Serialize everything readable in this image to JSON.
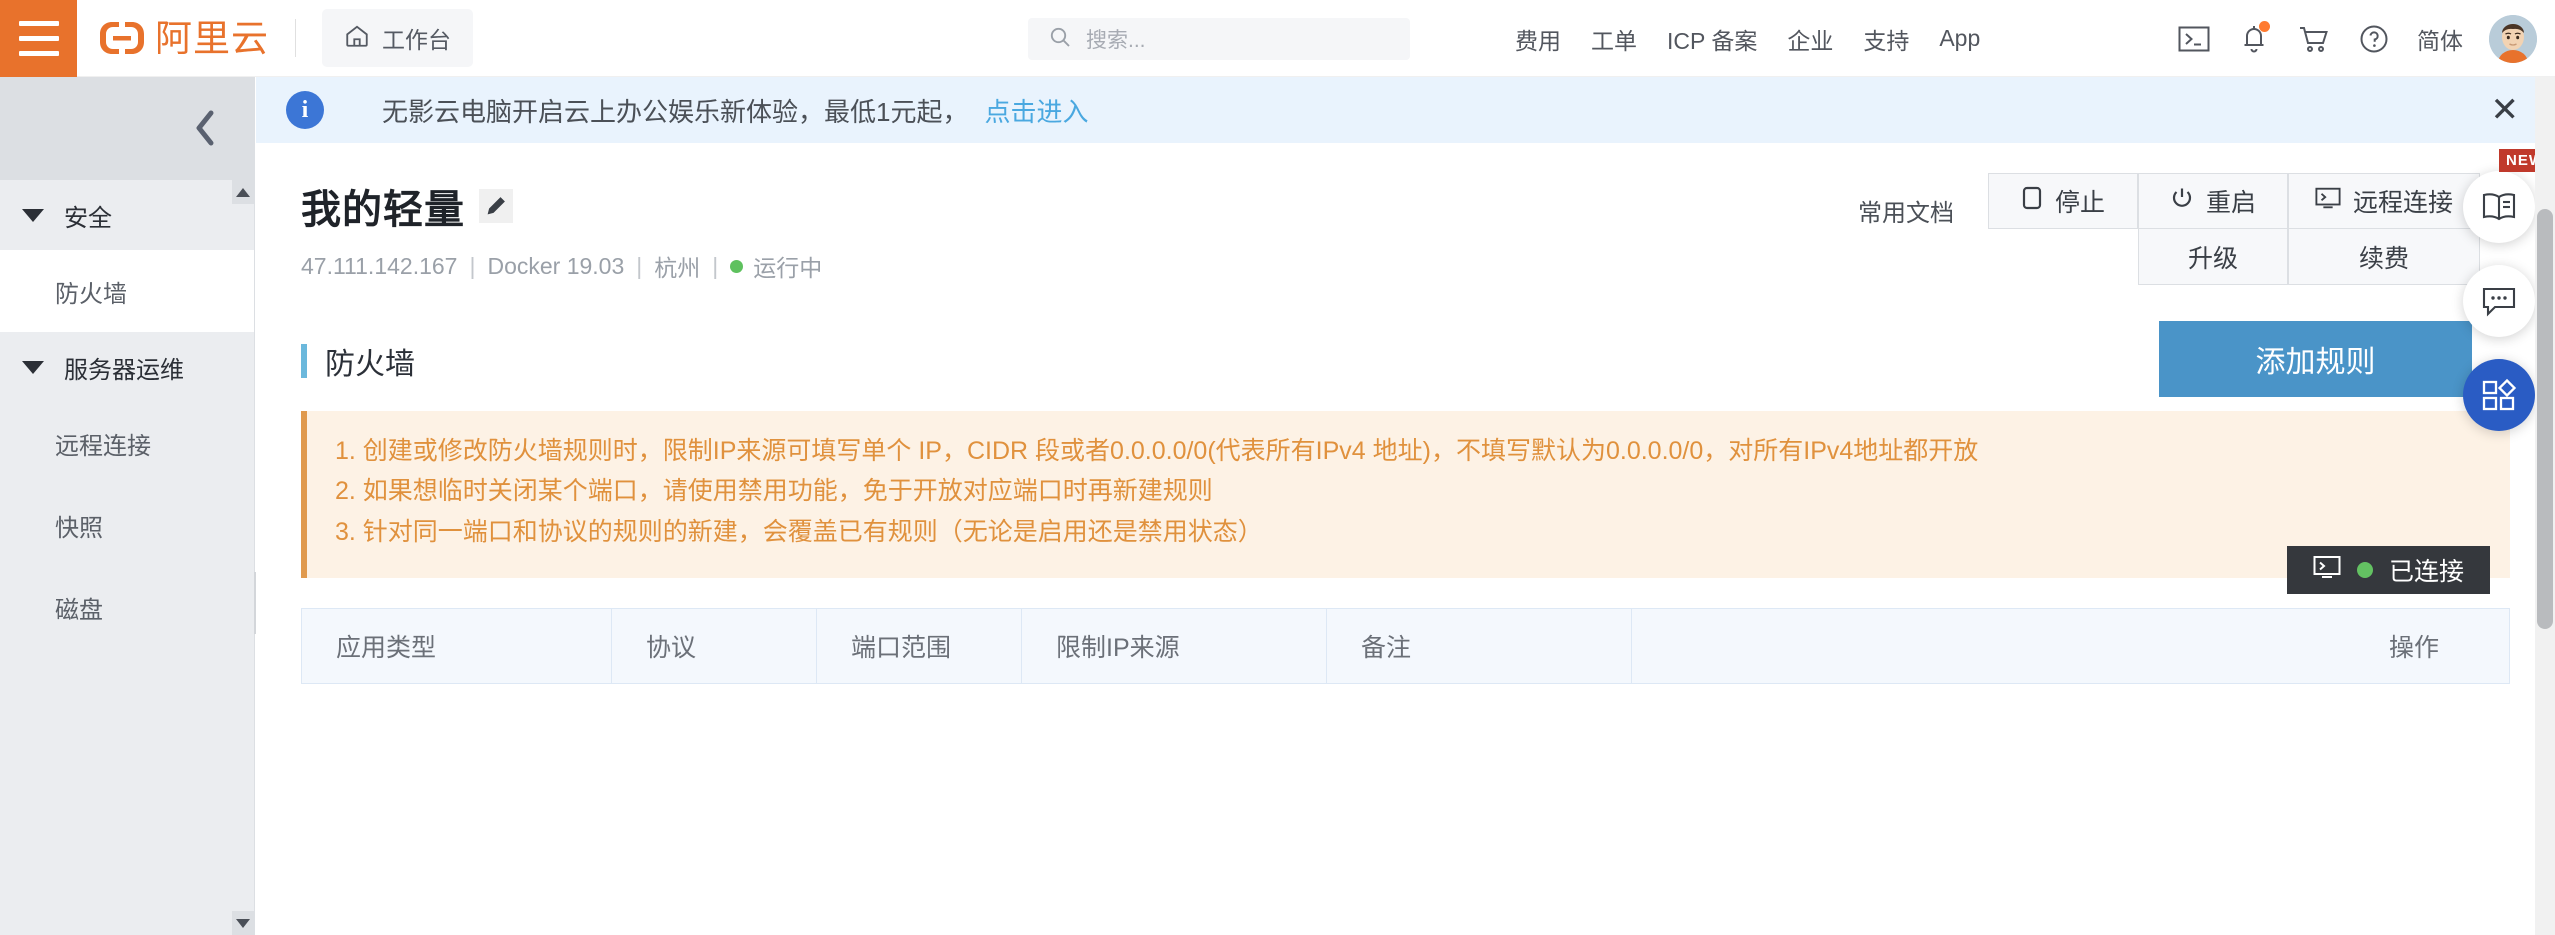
{
  "topnav": {
    "hamburger": "menu-icon",
    "brand": "阿里云",
    "workbench": "工作台",
    "search_placeholder": "搜索...",
    "links": [
      "费用",
      "工单",
      "ICP 备案",
      "企业",
      "支持",
      "App"
    ],
    "lang": "简体",
    "icons": [
      "terminal-icon",
      "bell-icon",
      "cart-icon",
      "help-icon"
    ]
  },
  "sidebar": {
    "collapse": "chevron-left-icon",
    "groups": [
      {
        "label": "安全",
        "items": [
          "防火墙"
        ]
      },
      {
        "label": "服务器运维",
        "items": [
          "远程连接",
          "快照",
          "磁盘"
        ]
      }
    ]
  },
  "promo": {
    "text": "无影云电脑开启云上办公娱乐新体验，最低1元起，",
    "link": "点击进入",
    "close": "✕"
  },
  "instance": {
    "title": "我的轻量",
    "ip": "47.111.142.167",
    "image": "Docker 19.03",
    "region": "杭州",
    "status": "运行中"
  },
  "actions": {
    "docs": "常用文档",
    "stop": "停止",
    "restart": "重启",
    "upgrade": "升级",
    "remote": "远程连接",
    "renew": "续费"
  },
  "section": {
    "title": "防火墙",
    "add_rule": "添加规则"
  },
  "notice": [
    "1. 创建或修改防火墙规则时，限制IP来源可填写单个 IP，CIDR 段或者0.0.0.0/0(代表所有IPv4 地址)，不填写默认为0.0.0.0/0，对所有IPv4地址都开放",
    "2. 如果想临时关闭某个端口，请使用禁用功能，免于开放对应端口时再新建规则",
    "3. 针对同一端口和协议的规则的新建，会覆盖已有规则（无论是启用还是禁用状态）"
  ],
  "table": {
    "columns": [
      "应用类型",
      "协议",
      "端口范围",
      "限制IP来源",
      "备注",
      "操作"
    ]
  },
  "fabs": [
    {
      "name": "docs-fab",
      "badge": "NEW"
    },
    {
      "name": "chat-fab",
      "badge": ""
    },
    {
      "name": "apps-fab",
      "badge": ""
    }
  ],
  "toast": {
    "label": "已连接",
    "icon": "terminal-icon"
  },
  "colors": {
    "brand_orange": "#e8722c",
    "primary_blue": "#4a94c8",
    "notice_orange": "#e0913d",
    "status_green": "#5ec15e",
    "promo_bg": "#e9f3fd"
  }
}
